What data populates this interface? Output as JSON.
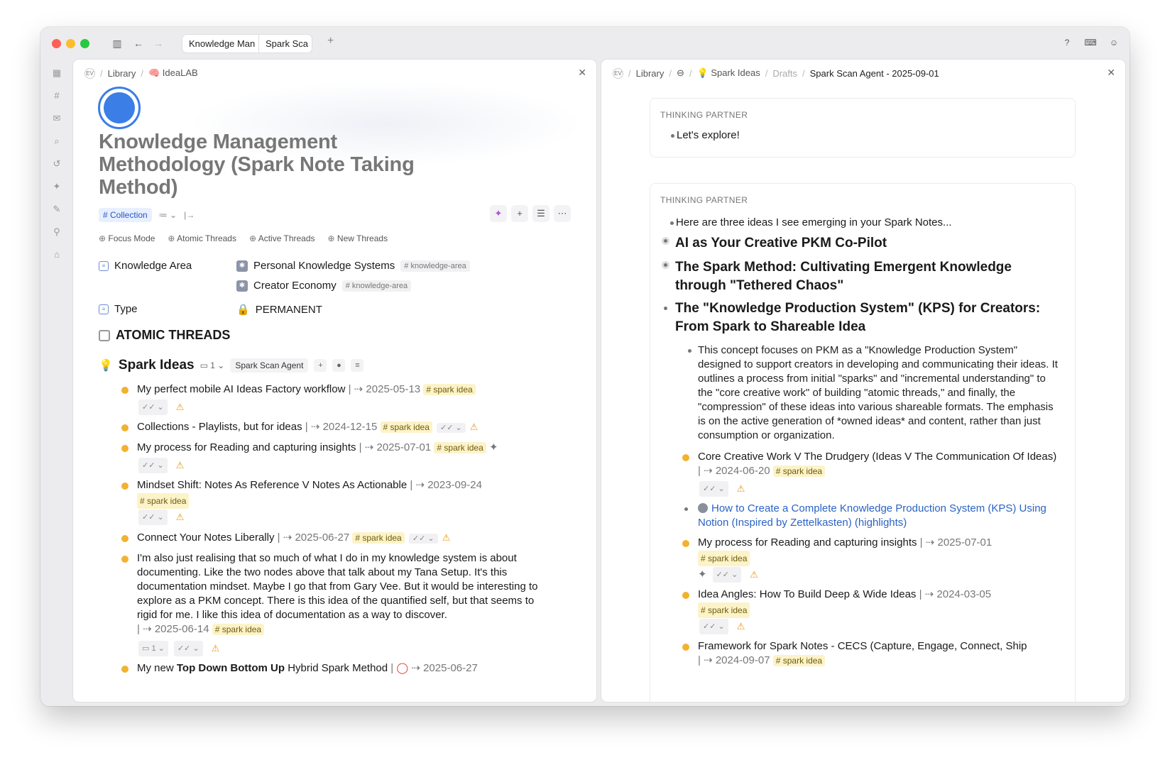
{
  "tabs": [
    "Knowledge Man",
    "Spark Sca"
  ],
  "left": {
    "breadcrumb": {
      "workspace": "EV",
      "library": "Library",
      "current": "🧠 IdeaLAB"
    },
    "title": "Knowledge Management Methodology (Spark Note Taking Method)",
    "collection_tag": "# Collection",
    "filters": [
      "Focus Mode",
      "Atomic Threads",
      "Active Threads",
      "New Threads"
    ],
    "fields": {
      "knowledge_area": {
        "label": "Knowledge Area",
        "values": [
          "Personal Knowledge Systems",
          "Creator Economy"
        ],
        "tag": "# knowledge-area"
      },
      "type": {
        "label": "Type",
        "value": "PERMANENT"
      }
    },
    "section_title": "ATOMIC THREADS",
    "spark": {
      "name": "Spark Ideas",
      "count": "1",
      "agent": "Spark Scan Agent"
    },
    "tag": "# spark idea",
    "items": [
      {
        "title": "My perfect mobile AI Ideas Factory workflow",
        "date": "2025-05-13"
      },
      {
        "title": "Collections - Playlists, but for ideas",
        "date": "2024-12-15"
      },
      {
        "title": "My process for Reading and capturing insights",
        "date": "2025-07-01"
      },
      {
        "title": "Mindset Shift: Notes As Reference V Notes As Actionable",
        "date": "2023-09-24"
      },
      {
        "title": "Connect Your Notes Liberally",
        "date": "2025-06-27"
      },
      {
        "title": "I'm also just realising that so much of what I do in my knowledge system is about documenting. Like the two nodes above that talk about my Tana Setup. It's this documentation mindset. Maybe I go that from Gary Vee. But it would be interesting to explore as a PKM concept. There is this idea of the quantified self, but that seems to rigid for me. I like this idea of documentation as a way to discover.",
        "date": "2025-06-14"
      },
      {
        "title_a": "My new ",
        "title_b": "Top Down Bottom Up",
        "title_c": " Hybrid Spark Method",
        "date": "2025-06-27"
      }
    ]
  },
  "right": {
    "breadcrumb": {
      "workspace": "EV",
      "library": "Library",
      "spark": "Spark Ideas",
      "drafts": "Drafts",
      "current": "Spark Scan Agent - 2025-09-01"
    },
    "card1": {
      "label": "THINKING PARTNER",
      "text": "Let's explore!"
    },
    "card2": {
      "label": "THINKING PARTNER",
      "intro": "Here are three ideas I see emerging in your Spark Notes...",
      "ideas": [
        "AI as Your Creative PKM Co-Pilot",
        "The Spark Method: Cultivating Emergent Knowledge through \"Tethered Chaos\"",
        "The \"Knowledge Production System\" (KPS) for Creators: From Spark to Shareable Idea"
      ],
      "paragraph": "This concept focuses on PKM as a \"Knowledge Production System\" designed to support creators in developing and communicating their ideas. It outlines a process from initial \"sparks\" and \"incremental understanding\" to the \"core creative work\" of building \"atomic threads,\" and finally, the \"compression\" of these ideas into various shareable formats. The emphasis is on the active generation of *owned ideas* and content, rather than just consumption or organization.",
      "subitems": [
        {
          "title": "Core Creative Work V The Drudgery (Ideas V The Communication Of Ideas)",
          "date": "2024-06-20"
        },
        {
          "link": "How to Create a Complete Knowledge Production System (KPS) Using Notion (Inspired by Zettelkasten) (highlights)"
        },
        {
          "title": "My process for Reading and capturing insights",
          "date": "2025-07-01"
        },
        {
          "title": "Idea Angles: How To Build Deep & Wide Ideas",
          "date": "2024-03-05"
        },
        {
          "title": "Framework for Spark Notes - CECS (Capture, Engage, Connect, Ship",
          "date": "2024-09-07"
        }
      ]
    }
  }
}
